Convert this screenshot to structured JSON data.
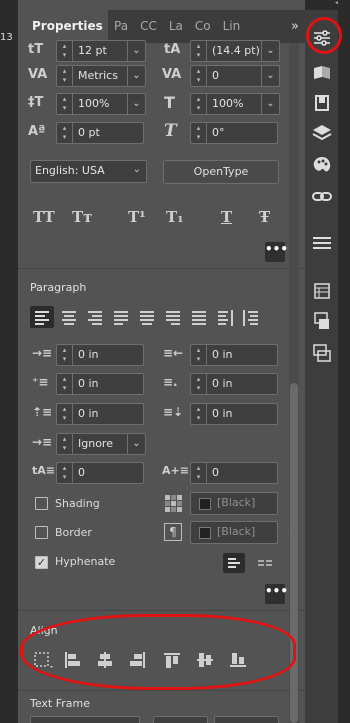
{
  "left_strip": {
    "number": "13"
  },
  "tabs": [
    {
      "label": "Properties",
      "active": true
    },
    {
      "label": "Pa"
    },
    {
      "label": "CC"
    },
    {
      "label": "La"
    },
    {
      "label": "Co"
    },
    {
      "label": "Lin"
    }
  ],
  "tabs_more": "»",
  "collapse_arrows": "◂◂",
  "character": {
    "font_size": "12 pt",
    "leading": "(14.4 pt)",
    "kerning": "Metrics",
    "tracking": "0",
    "vertical_scale": "100%",
    "horizontal_scale": "100%",
    "baseline_shift": "0 pt",
    "skew": "0°",
    "language": "English: USA",
    "opentype_label": "OpenType",
    "style_glyphs": [
      "TT",
      "Tт",
      "T¹",
      "T₁",
      "T",
      "Ŧ"
    ]
  },
  "paragraph": {
    "header": "Paragraph",
    "left_indent": "0 in",
    "right_indent": "0 in",
    "first_line_indent": "0 in",
    "last_line_indent": "0 in",
    "space_before": "0 in",
    "space_after": "0 in",
    "align_to_grid": "Ignore",
    "drop_cap_lines": "0",
    "drop_cap_chars": "0",
    "shading_label": "Shading",
    "shading_checked": false,
    "shading_swatch": "[Black]",
    "border_label": "Border",
    "border_checked": false,
    "border_swatch": "[Black]",
    "hyphenate_label": "Hyphenate",
    "hyphenate_checked": true
  },
  "align": {
    "header": "Align"
  },
  "text_frame": {
    "header": "Text Frame"
  },
  "more_options_glyph": "•••",
  "colors": {
    "annotation": "#e01313",
    "panel": "#535353",
    "field": "#3f3f3f"
  }
}
